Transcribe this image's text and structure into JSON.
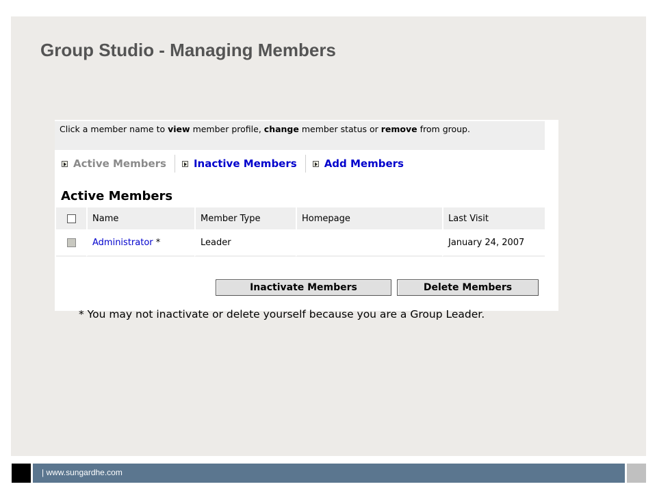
{
  "slide": {
    "title": "Group Studio - Managing Members"
  },
  "instructions": {
    "t1": "Click a member name to ",
    "b1": "view",
    "t2": " member profile, ",
    "b2": "change",
    "t3": " member status or ",
    "b3": "remove",
    "t4": " from group."
  },
  "nav": {
    "items": [
      {
        "label": "Active Members",
        "state": "active"
      },
      {
        "label": "Inactive Members",
        "state": "link"
      },
      {
        "label": "Add Members",
        "state": "link"
      }
    ]
  },
  "section": {
    "title": "Active Members"
  },
  "table": {
    "headers": [
      "Name",
      "Member Type",
      "Homepage",
      "Last Visit"
    ],
    "rows": [
      {
        "name": "Administrator",
        "marker": "*",
        "member_type": "Leader",
        "homepage": "",
        "last_visit": "January 24, 2007"
      }
    ]
  },
  "buttons": {
    "inactivate": "Inactivate Members",
    "delete": "Delete Members"
  },
  "note": "* You may not inactivate or delete yourself because you are a Group Leader.",
  "footer": {
    "text": "| www.sungardhe.com"
  },
  "colors": {
    "link": "#0000cc",
    "footer_bar": "#5b768f",
    "slide_bg": "#edebe8"
  },
  "icons": {
    "nav_arrow": "play-arrow-box-icon"
  }
}
